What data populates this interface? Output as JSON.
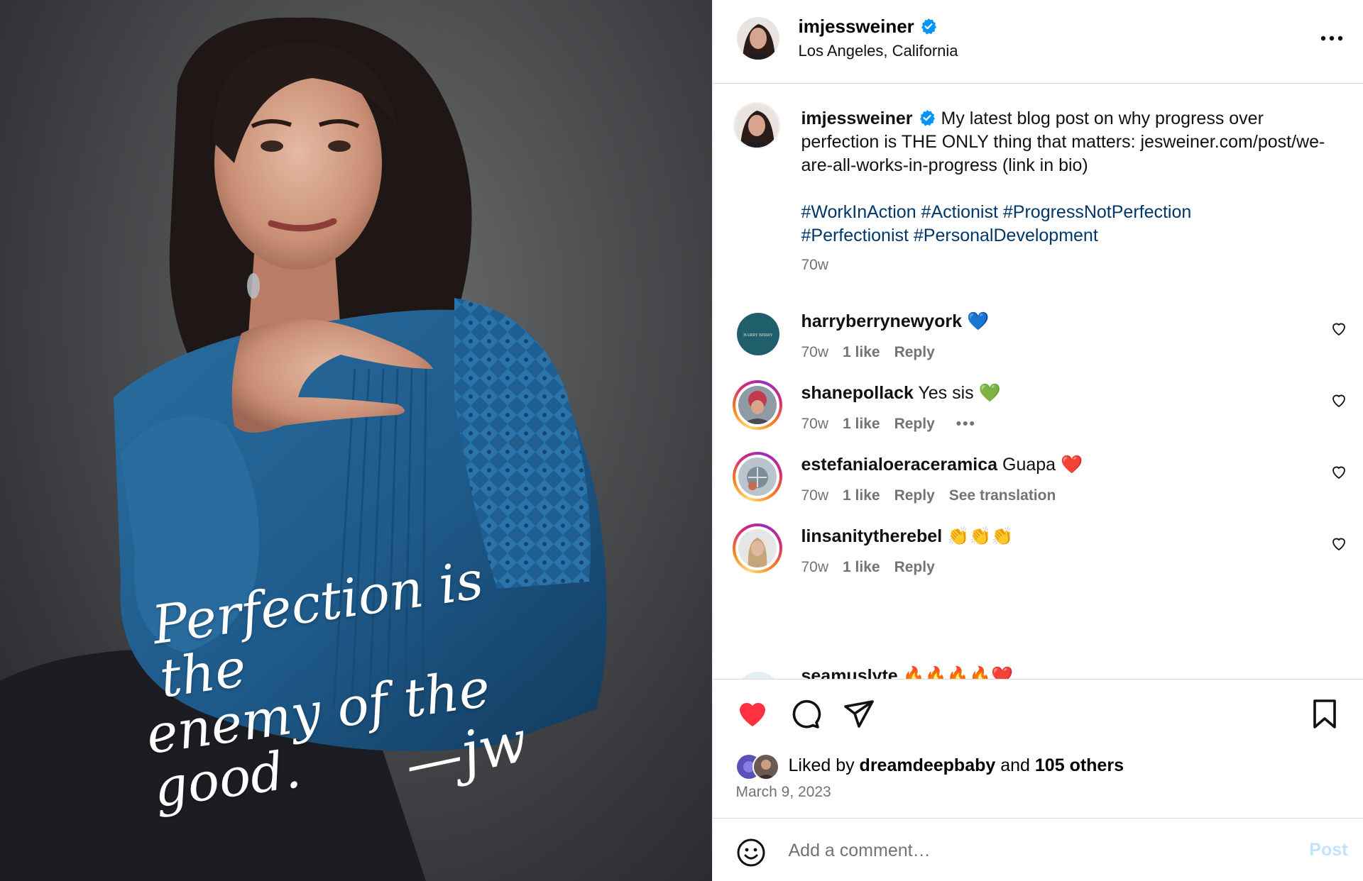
{
  "post": {
    "author": "imjessweiner",
    "location": "Los Angeles, California",
    "image": {
      "quote_line1": "Perfection is the",
      "quote_line2": "enemy of the good.",
      "signature": "—jw"
    },
    "caption": {
      "text": "My latest blog post on why progress over perfection is THE ONLY thing that matters: jesweiner.com/post/we-are-all-works-in-progress (link in bio)",
      "hashtags": [
        "#WorkInAction",
        "#Actionist",
        "#ProgressNotPerfection",
        "#Perfectionist",
        "#PersonalDevelopment"
      ],
      "time": "70w"
    }
  },
  "comments": [
    {
      "username": "harryberrynewyork",
      "text": "💙",
      "time": "70w",
      "likes": "1 like",
      "reply": "Reply",
      "avatar_label": "HARRY BERRY"
    },
    {
      "username": "shanepollack",
      "text": "Yes sis 💚",
      "time": "70w",
      "likes": "1 like",
      "reply": "Reply",
      "extra": "•••"
    },
    {
      "username": "estefanialoeraceramica",
      "text": "Guapa ❤️",
      "time": "70w",
      "likes": "1 like",
      "reply": "Reply",
      "extra": "See translation"
    },
    {
      "username": "linsanitytherebel",
      "text": "👏👏👏",
      "time": "70w",
      "likes": "1 like",
      "reply": "Reply"
    },
    {
      "username": "seamuslyte",
      "text": "🔥🔥🔥🔥❤️"
    }
  ],
  "engagement": {
    "liked_by_prefix": "Liked by ",
    "liked_by_user": "dreamdeepbaby",
    "liked_by_and": " and ",
    "liked_by_others": "105 others",
    "date": "March 9, 2023",
    "liked": true
  },
  "composer": {
    "placeholder": "Add a comment…",
    "post_label": "Post"
  },
  "colors": {
    "like_red": "#ff3040",
    "hashtag_blue": "#00376b",
    "verified_blue": "#0095f6",
    "post_button_disabled": "#c4e2fb",
    "photo_blouse_blue": "#1e5a8a"
  },
  "icons": [
    "verified-icon",
    "more-icon",
    "heart-outline-icon",
    "heart-filled-icon",
    "comment-icon",
    "share-icon",
    "bookmark-icon",
    "emoji-icon"
  ]
}
